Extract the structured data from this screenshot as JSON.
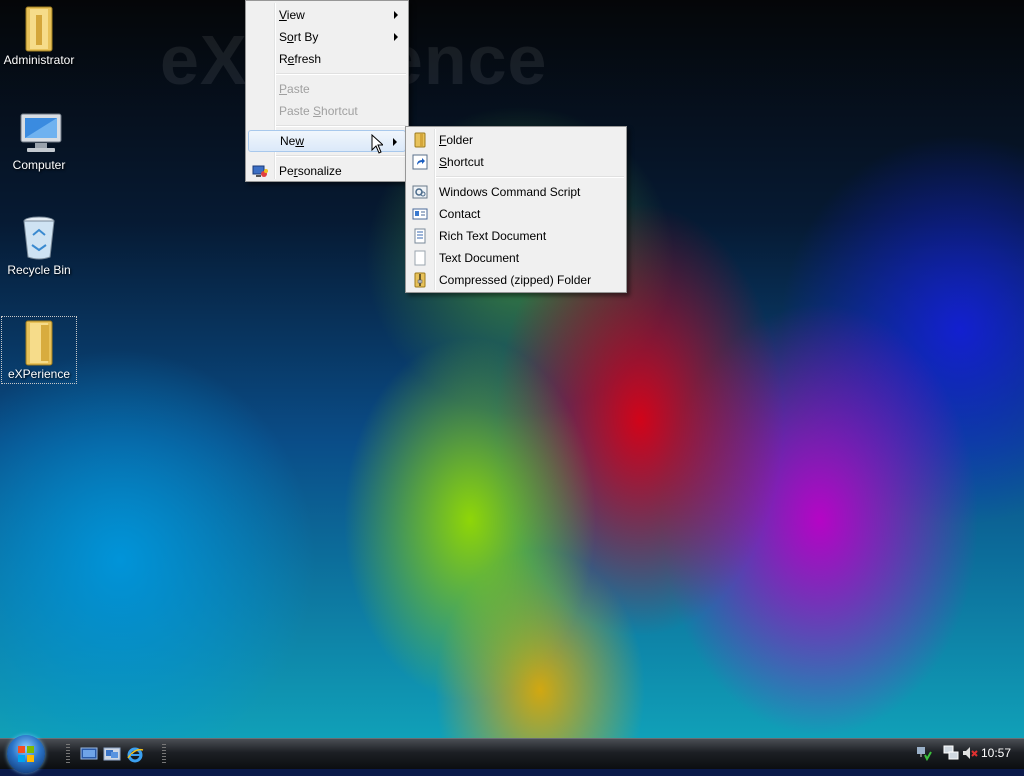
{
  "desktop": {
    "watermark": "eXPerience",
    "icons": [
      {
        "label": "Administrator",
        "icon": "user-folder-icon"
      },
      {
        "label": "Computer",
        "icon": "computer-icon"
      },
      {
        "label": "Recycle Bin",
        "icon": "recycle-bin-icon"
      },
      {
        "label": "eXPerience",
        "icon": "folder-icon",
        "selected": true
      }
    ]
  },
  "context_menu": {
    "items": [
      {
        "pre": "",
        "u": "V",
        "post": "iew",
        "submenu": true
      },
      {
        "pre": "S",
        "u": "o",
        "post": "rt By",
        "submenu": true
      },
      {
        "pre": "R",
        "u": "e",
        "post": "fresh"
      },
      {
        "pre": "",
        "u": "P",
        "post": "aste",
        "disabled": true
      },
      {
        "pre": "Paste ",
        "u": "S",
        "post": "hortcut",
        "disabled": true
      },
      {
        "pre": "Ne",
        "u": "w",
        "post": "",
        "submenu": true,
        "highlighted": true
      },
      {
        "pre": "Pe",
        "u": "r",
        "post": "sonalize",
        "icon": "personalize-icon"
      }
    ]
  },
  "new_submenu": {
    "items": [
      {
        "pre": "",
        "u": "F",
        "post": "older",
        "icon": "folder-icon"
      },
      {
        "pre": "",
        "u": "S",
        "post": "hortcut",
        "icon": "shortcut-icon"
      },
      {
        "label": "Windows Command Script",
        "icon": "script-icon"
      },
      {
        "label": "Contact",
        "icon": "contact-icon"
      },
      {
        "label": "Rich Text Document",
        "icon": "rich-text-icon"
      },
      {
        "label": "Text Document",
        "icon": "text-document-icon"
      },
      {
        "label": "Compressed (zipped) Folder",
        "icon": "zip-folder-icon"
      }
    ]
  },
  "taskbar": {
    "quick_launch": [
      "show-desktop-icon",
      "switch-windows-icon",
      "internet-explorer-icon"
    ],
    "tray_icons": [
      "update-icon",
      "network-icon",
      "volume-muted-icon"
    ],
    "clock": "10:57"
  },
  "colors": {
    "menu_bg": "#f0f0f0",
    "highlight_border": "#a8c8ec",
    "disabled_text": "#a0a0a0"
  }
}
